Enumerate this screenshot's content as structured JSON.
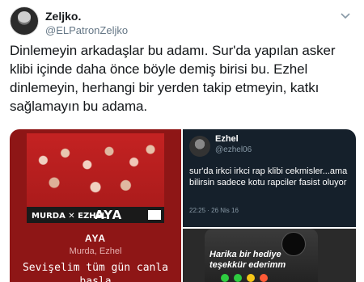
{
  "author": {
    "name": "Zeljko.",
    "handle": "@ELPatronZeljko"
  },
  "tweet": {
    "text": "Dinlemeyin arkadaşlar bu adamı. Sur'da yapılan asker klibi içinde daha önce böyle demiş birisi bu. Ezhel dinlemeyin, herhangi bir yerden takip etmeyin, katkı sağlamayın bu adama."
  },
  "media": {
    "song_card": {
      "album_logo_left": "MURDA ✕ EZHEL",
      "album_logo_right": "AYA",
      "title": "AYA",
      "artists": "Murda, Ezhel",
      "lyric": "Sevişelim tüm gün canla başla"
    },
    "quoted_tweet": {
      "name": "Ezhel",
      "handle": "@ezhel06",
      "text": "sur'da irkci irkci rap klibi cekmisler...ama bilirsin sadece kotu rapciler fasist oluyor",
      "time": "22:25 · 26 Nis 16"
    },
    "phone_photo": {
      "text": "Harika bir hediye teşekkür ederimm"
    }
  },
  "icons": {
    "menu": "chevron-down-icon"
  },
  "colors": {
    "song_card_bg": "#8e1616",
    "quoted_tweet_bg": "#15202b",
    "handle_gray": "#657786"
  }
}
